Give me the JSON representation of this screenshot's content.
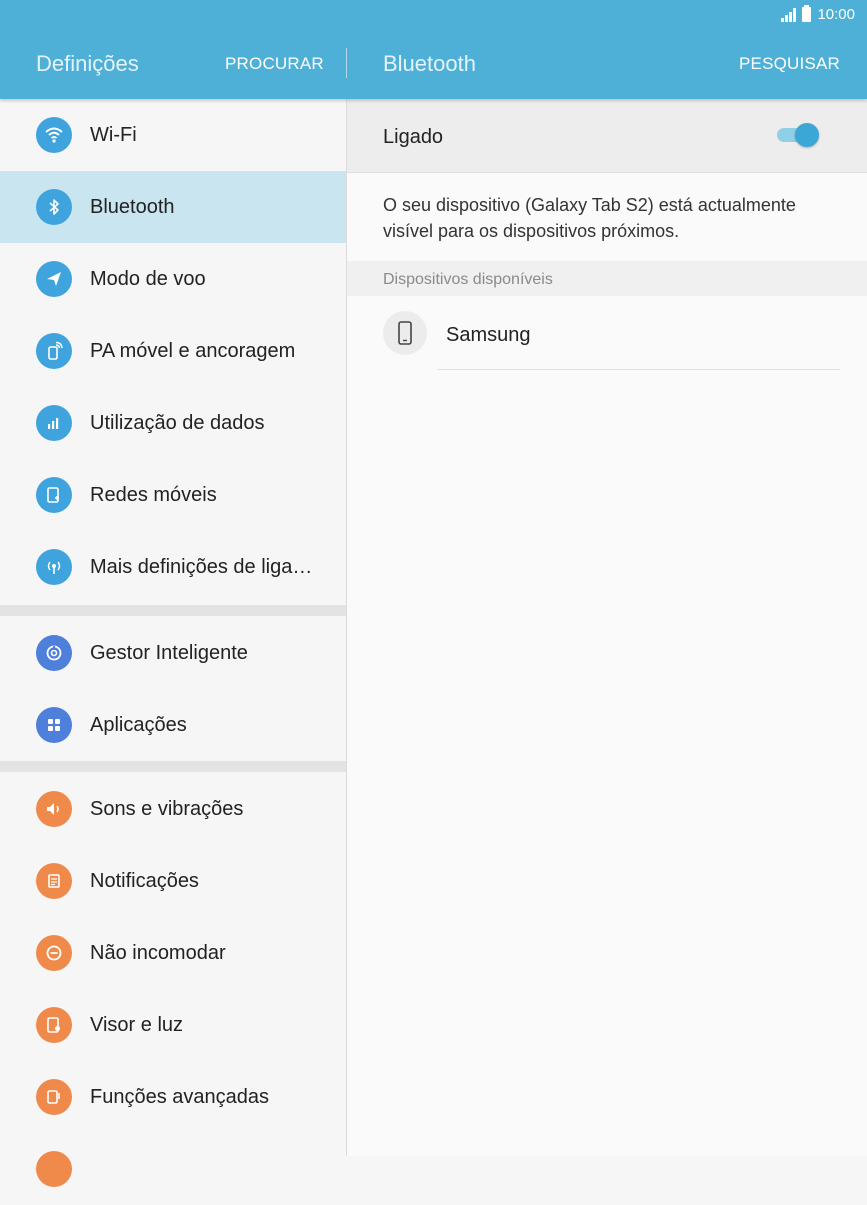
{
  "status_bar": {
    "time": "10:00",
    "signal_icon": "signal-icon",
    "battery_icon": "battery-icon"
  },
  "app_bar": {
    "left_title": "Definições",
    "left_action": "PROCURAR",
    "right_title": "Bluetooth",
    "right_action": "PESQUISAR"
  },
  "colors": {
    "header": "#4fb0d7",
    "selected_row": "#c9e6f0",
    "blue_icon": "#3fa4de",
    "orange_icon": "#f08a4b"
  },
  "sidebar": {
    "items": [
      {
        "label": "Wi-Fi",
        "icon": "wifi-icon"
      },
      {
        "label": "Bluetooth",
        "icon": "bluetooth-icon",
        "selected": true
      },
      {
        "label": "Modo de voo",
        "icon": "airplane-icon"
      },
      {
        "label": "PA móvel e ancoragem",
        "icon": "hotspot-icon"
      },
      {
        "label": "Utilização de dados",
        "icon": "data-usage-icon"
      },
      {
        "label": "Redes móveis",
        "icon": "mobile-networks-icon"
      },
      {
        "label": "Mais definições de liga…",
        "icon": "more-connections-icon"
      },
      {
        "label": "Gestor Inteligente",
        "icon": "smart-manager-icon"
      },
      {
        "label": "Aplicações",
        "icon": "apps-icon"
      },
      {
        "label": "Sons e vibrações",
        "icon": "sound-icon"
      },
      {
        "label": "Notificações",
        "icon": "notifications-icon"
      },
      {
        "label": "Não incomodar",
        "icon": "do-not-disturb-icon"
      },
      {
        "label": "Visor e luz",
        "icon": "display-icon"
      },
      {
        "label": "Funções avançadas",
        "icon": "advanced-features-icon"
      }
    ]
  },
  "bluetooth": {
    "toggle_label": "Ligado",
    "toggle_on": true,
    "description": "O seu dispositivo (Galaxy Tab S2) está actualmente visível para os dispositivos próximos.",
    "section_label": "Dispositivos disponíveis",
    "devices": [
      {
        "name": "Samsung",
        "icon": "phone-icon"
      }
    ]
  }
}
